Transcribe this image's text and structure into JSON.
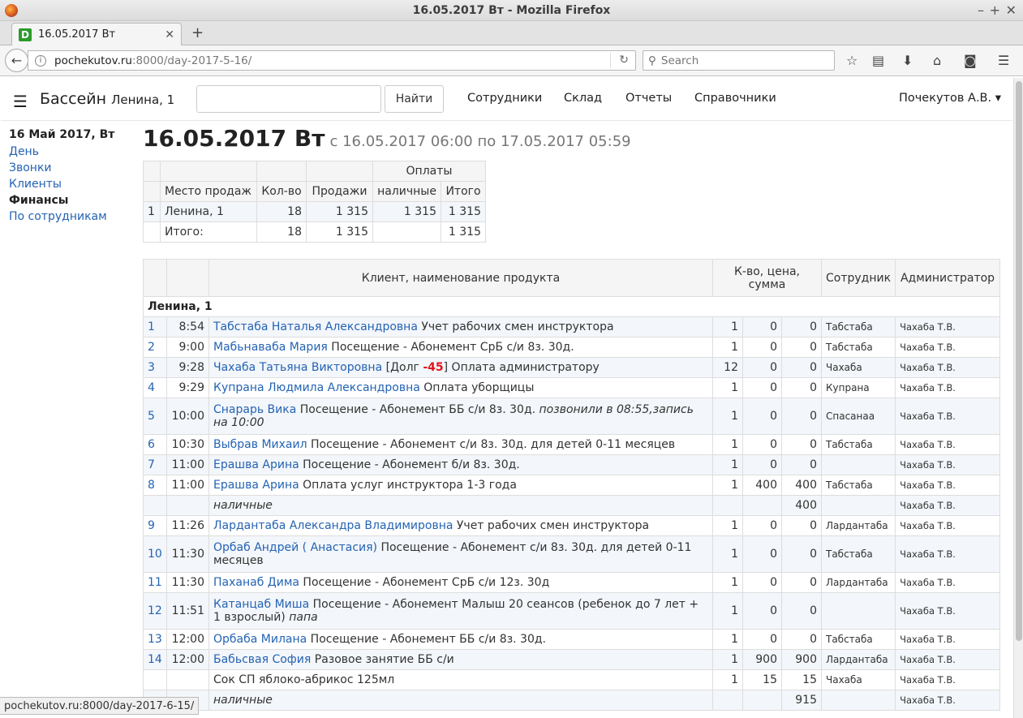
{
  "window": {
    "title": "16.05.2017 Вт - Mozilla Firefox"
  },
  "tab": {
    "favicon": "D",
    "label": "16.05.2017 Вт"
  },
  "url": {
    "host": "pochekutov.ru",
    "rest": ":8000/day-2017-5-16/"
  },
  "search": {
    "placeholder": "Search"
  },
  "app": {
    "brand": "Бассейн",
    "brand_sub": "Ленина, 1",
    "search_button": "Найти",
    "menu": [
      "Сотрудники",
      "Склад",
      "Отчеты",
      "Справочники"
    ],
    "user": "Почекутов А.В. ▾"
  },
  "sidebar": {
    "date": "16 Май 2017, Вт",
    "links": [
      "День",
      "Звонки",
      "Клиенты",
      "Финансы",
      "По сотрудникам"
    ]
  },
  "heading": {
    "title": "16.05.2017 Вт",
    "period": "с 16.05.2017 06:00 по 17.05.2017 05:59"
  },
  "summary": {
    "group_header": "Оплаты",
    "headers": [
      "Место продаж",
      "Кол-во",
      "Продажи",
      "наличные",
      "Итого"
    ],
    "rows": [
      {
        "n": "1",
        "place": "Ленина, 1",
        "qty": "18",
        "sales": "1 315",
        "cash": "1 315",
        "total": "1 315"
      },
      {
        "n": "",
        "place": "Итого:",
        "qty": "18",
        "sales": "1 315",
        "cash": "",
        "total": "1 315"
      }
    ]
  },
  "detail": {
    "headers": {
      "client": "Клиент, наименование продукта",
      "qty": "К-во, цена, сумма",
      "employee": "Сотрудник",
      "admin": "Администратор"
    },
    "group": "Ленина, 1",
    "rows": [
      {
        "n": "1",
        "time": "8:54",
        "client": "Табстаба Наталья Александровна",
        "product": " Учет рабочих смен инструктора",
        "qty": "1",
        "price": "0",
        "sum": "0",
        "employee": "Табстаба",
        "admin": "Чахаба Т.В."
      },
      {
        "n": "2",
        "time": "9:00",
        "client": "Мабьнаваба Мария",
        "product": " Посещение - Абонемент СрБ с/и 8з. 30д.",
        "qty": "1",
        "price": "0",
        "sum": "0",
        "employee": "Табстаба",
        "admin": "Чахаба Т.В."
      },
      {
        "n": "3",
        "time": "9:28",
        "client": "Чахаба Татьяна Викторовна",
        "product_pre": " [Долг ",
        "debt": "-45",
        "product": "] Оплата администратору",
        "qty": "12",
        "price": "0",
        "sum": "0",
        "employee": "Чахаба",
        "admin": "Чахаба Т.В."
      },
      {
        "n": "4",
        "time": "9:29",
        "client": "Купрана Людмила Александровна",
        "product": " Оплата уборщицы",
        "qty": "1",
        "price": "0",
        "sum": "0",
        "employee": "Купрана",
        "admin": "Чахаба Т.В."
      },
      {
        "n": "5",
        "time": "10:00",
        "client": "Снарарь Вика",
        "product": " Посещение - Абонемент ББ с/и 8з. 30д. ",
        "note": "позвонили в 08:55,запись на 10:00",
        "qty": "1",
        "price": "0",
        "sum": "0",
        "employee": "Спасанаа",
        "admin": "Чахаба Т.В."
      },
      {
        "n": "6",
        "time": "10:30",
        "client": "Выбрав Михаил",
        "product": " Посещение - Абонемент с/и 8з. 30д. для детей 0-11 месяцев",
        "qty": "1",
        "price": "0",
        "sum": "0",
        "employee": "Табстаба",
        "admin": "Чахаба Т.В."
      },
      {
        "n": "7",
        "time": "11:00",
        "client": "Ерашва Арина",
        "product": " Посещение - Абонемент б/и 8з. 30д.",
        "qty": "1",
        "price": "0",
        "sum": "0",
        "employee": "",
        "admin": "Чахаба Т.В."
      },
      {
        "n": "8",
        "time": "11:00",
        "client": "Ерашва Арина",
        "product": " Оплата услуг инструктора 1-3 года",
        "qty": "1",
        "price": "400",
        "sum": "400",
        "employee": "Табстаба",
        "admin": "Чахаба Т.В."
      },
      {
        "subtotal": "наличные",
        "sum": "400",
        "admin": "Чахаба Т.В."
      },
      {
        "n": "9",
        "time": "11:26",
        "client": "Лардантаба Александра Владимировна",
        "product": " Учет рабочих смен инструктора",
        "qty": "1",
        "price": "0",
        "sum": "0",
        "employee": "Лардантаба",
        "admin": "Чахаба Т.В."
      },
      {
        "n": "10",
        "time": "11:30",
        "client": "Орбаб Андрей ( Анастасия)",
        "product": " Посещение - Абонемент с/и 8з. 30д. для детей 0-11 месяцев",
        "qty": "1",
        "price": "0",
        "sum": "0",
        "employee": "Табстаба",
        "admin": "Чахаба Т.В."
      },
      {
        "n": "11",
        "time": "11:30",
        "client": "Паханаб Дима",
        "product": " Посещение - Абонемент СрБ с/и 12з. 30д",
        "qty": "1",
        "price": "0",
        "sum": "0",
        "employee": "Лардантаба",
        "admin": "Чахаба Т.В."
      },
      {
        "n": "12",
        "time": "11:51",
        "client": "Катанцаб Миша",
        "product": " Посещение - Абонемент Малыш 20 сеансов (ребенок до 7 лет + 1 взрослый) ",
        "note": "папа",
        "qty": "1",
        "price": "0",
        "sum": "0",
        "employee": "",
        "admin": "Чахаба Т.В."
      },
      {
        "n": "13",
        "time": "12:00",
        "client": "Орбаба Милана",
        "product": " Посещение - Абонемент ББ с/и 8з. 30д.",
        "qty": "1",
        "price": "0",
        "sum": "0",
        "employee": "Табстаба",
        "admin": "Чахаба Т.В."
      },
      {
        "n": "14",
        "time": "12:00",
        "client": "Бабьсвая София",
        "product": " Разовое занятие ББ с/и",
        "qty": "1",
        "price": "900",
        "sum": "900",
        "employee": "Лардантаба",
        "admin": "Чахаба Т.В."
      },
      {
        "n": "",
        "time": "",
        "client": "",
        "product": "Сок СП яблоко-абрикос 125мл",
        "qty": "1",
        "price": "15",
        "sum": "15",
        "employee": "Чахаба",
        "admin": "Чахаба Т.В."
      },
      {
        "subtotal": "наличные",
        "sum": "915",
        "admin": "Чахаба Т.В."
      }
    ]
  },
  "status": "pochekutov.ru:8000/day-2017-6-15/"
}
